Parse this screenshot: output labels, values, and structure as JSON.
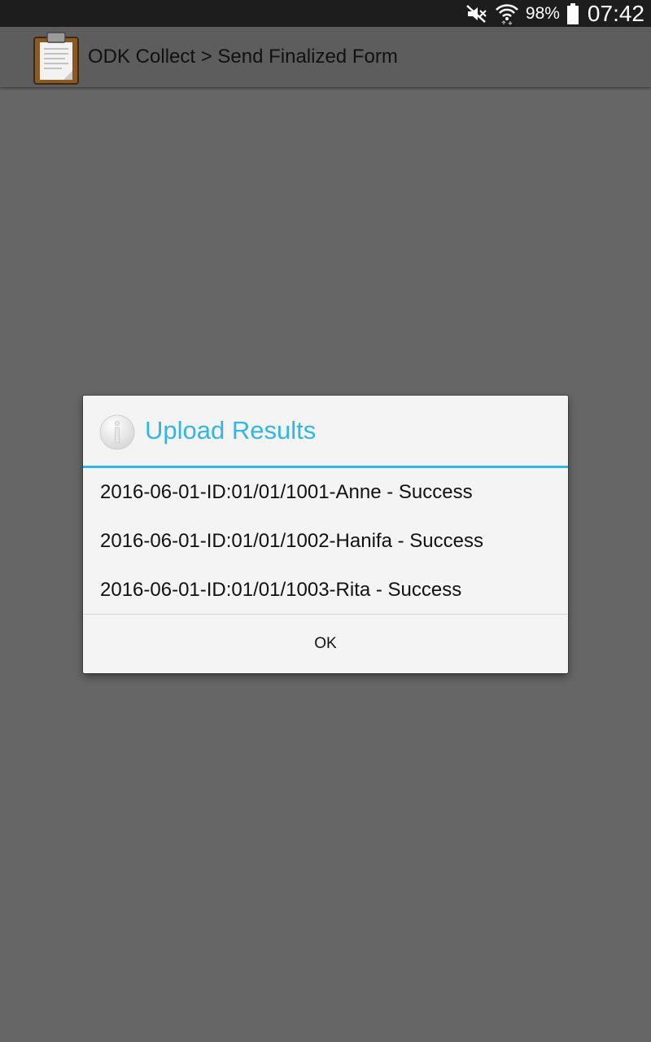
{
  "status_bar": {
    "battery_percent": "98%",
    "time": "07:42",
    "icons": [
      "mute-icon",
      "wifi-icon",
      "battery-icon"
    ]
  },
  "app_bar": {
    "title": "ODK Collect > Send Finalized Form",
    "icon": "clipboard-icon"
  },
  "dialog": {
    "icon": "info-icon",
    "title": "Upload Results",
    "results": [
      "2016-06-01-ID:01/01/1001-Anne - Success",
      "2016-06-01-ID:01/01/1002-Hanifa - Success",
      "2016-06-01-ID:01/01/1003-Rita - Success"
    ],
    "ok_label": "OK"
  },
  "colors": {
    "accent": "#33b5e5",
    "background": "#666666",
    "status_bar": "#1d1d1d",
    "app_bar": "#5d5d5d",
    "dialog_bg": "#f4f4f4"
  }
}
